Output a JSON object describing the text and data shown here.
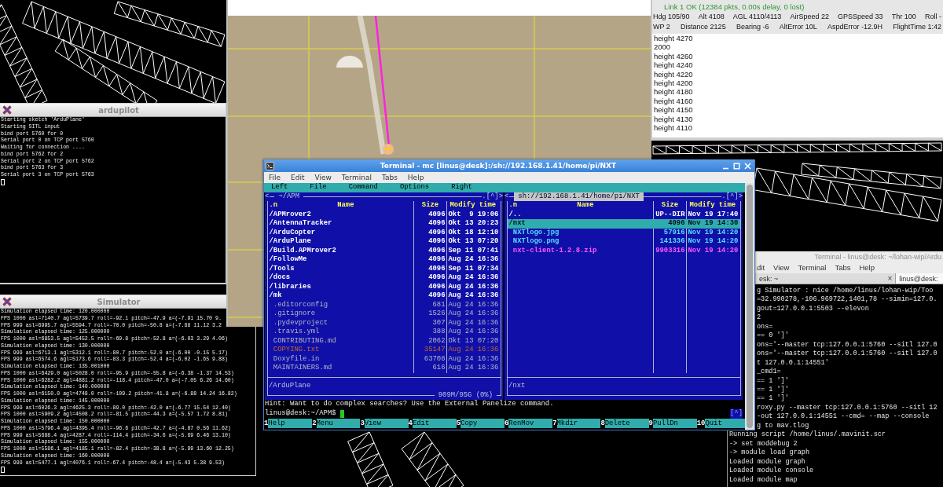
{
  "ardupilot_window": {
    "title": "ardupilot",
    "lines": [
      "Starting sketch 'ArduPlane'",
      "Starting SITL input",
      "bind port 5760 for 0",
      "Serial port 0 on TCP port 5760",
      "Waiting for connection ....",
      "bind port 5762 for 2",
      "Serial port 2 on TCP port 5762",
      "bind port 5763 for 3",
      "Serial port 3 on TCP port 5763"
    ]
  },
  "simulator_window": {
    "title": "Simulator",
    "lines": [
      "Simulation elapsed time: 120.000000",
      "FPS 1000 asl=7140.7 agl=5739.7 roll=-92.1 pitch=-47.9 a=(-7.91 15.70 9.",
      "FPS 999 asl=6995.7 agl=5594.7 roll=-70.0 pitch=-50.8 a=(-7.68 11.12 3.2",
      "Simulation elapsed time: 125.000000",
      "FPS 1000 asl=6853.5 agl=5452.5 roll=-69.8 pitch=-52.8 a=(-6.03 3.29 4.06)",
      "Simulation elapsed time: 130.000000",
      "FPS 999 asl=6713.1 agl=5312.1 roll=-80.7 pitch=-52.0 a=(-6.00 -0.15 5.17)",
      "FPS 999 asl=6574.6 agl=5173.6 roll=-83.3 pitch=-52.4 a=(-6.02 -1.65 9.88)",
      "Simulation elapsed time: 135.001000",
      "FPS 1000 asl=6429.0 agl=5028.0 roll=-95.9 pitch=-55.8 a=(-6.38 -1.37 14.53)",
      "FPS 1000 asl=6282.2 agl=4881.2 roll=-118.4 pitch=-47.0 a=(-7.05 6.26 14.60)",
      "Simulation elapsed time: 140.000000",
      "FPS 1000 asl=6150.0 agl=4749.0 roll=-109.2 pitch=-41.8 a=(-6.88 14.24 16.82)",
      "Simulation elapsed time: 145.000000",
      "FPS 999 asl=6026.3 agl=4625.3 roll=-89.0 pitch=-42.0 a=(-6.77 15.54 12.40)",
      "FPS 1000 asl=5909.2 agl=4508.2 roll=-81.5 pitch=-44.3 a=(-5.57 1.72 8.81)",
      "Simulation elapsed time: 150.000000",
      "FPS 1000 asl=5796.4 agl=4395.4 roll=-96.6 pitch=-42.7 a=(-4.87 0.56 11.62)",
      "FPS 999 asl=5688.4 agl=4287.4 roll=-114.4 pitch=-34.6 a=(-5.69 6.46 13.10)",
      "Simulation elapsed time: 155.000000",
      "FPS 1000 asl=5586.1 agl=4185.1 roll=-82.4 pitch=-38.8 a=(-5.99 13.60 12.25)",
      "Simulation elapsed time: 160.000000",
      "FPS 999 asl=5477.1 agl=4076.1 roll=-67.4 pitch=-48.4 a=(-5.43 5.38 9.53)"
    ]
  },
  "mavproxy_console": {
    "link_status": "Link 1 OK (12384 pkts, 0.00s delay, 0 lost)",
    "link_ok": true,
    "status_rows": [
      [
        "Hdg 105/90",
        "Alt 4108",
        "AGL 4110/4113",
        "AirSpeed 22",
        "GPSSpeed 33",
        "Thr 100",
        "Roll -"
      ],
      [
        "WP 2",
        "Distance 2125",
        "Bearing -6",
        "AltError 10L",
        "AspdError -12.9H",
        "FlightTime 1:42"
      ]
    ],
    "messages": [
      "height 4270",
      "2000",
      "height 4260",
      "height 4240",
      "height 4220",
      "height 4200",
      "height 4180",
      "height 4160",
      "height 4150",
      "height 4130",
      "height 4110"
    ]
  },
  "lohan_terminal": {
    "title": "Terminal - linus@desk: ~/lohan-wip/Ardu",
    "menu": [
      "dit",
      "View",
      "Terminal",
      "Tabs",
      "Help"
    ],
    "tabs": [
      {
        "label": "esk: ~",
        "close": "×",
        "selected": false
      },
      {
        "label": "linus@desk:",
        "selected": true
      }
    ],
    "overlapped_lines": [
      "g Simulator : nice /home/linus/lohan-wip/Too",
      "=32.990278,-106.969722,1401,78 --simin=127.0.",
      "gout=127.0.0.1:5503 --elevon",
      "2",
      "ons=",
      "== 0 ']'",
      "ons='--master tcp:127.0.0.1:5760 --sitl 127.0",
      "ons='--master tcp:127.0.0.1:5760 --sitl 127.0",
      "t 127.0.0.1:14551'",
      "_cmd1=",
      "== 1 ']'",
      "== 1 ']'",
      "== 1 ']'",
      "roxy.py --master tcp:127.0.0.1:5760 --sitl 12",
      "-out 127.0.0.1:14551 --cmd= --map --console",
      "g to mav.tlog"
    ],
    "lines": [
      "Running script /home/linus/.mavinit.scr",
      "-> set moddebug 2",
      "-> module load graph",
      "Loaded module graph",
      "Loaded module console",
      "Loaded module map"
    ]
  },
  "mc_window": {
    "title": "Terminal - mc [linus@desk]:/sh://192.168.1.41/home/pi/NXT",
    "menu": [
      "File",
      "Edit",
      "View",
      "Terminal",
      "Tabs",
      "Help"
    ],
    "mc_menu": [
      "Left",
      "File",
      "Command",
      "Options",
      "Right"
    ],
    "panels": [
      {
        "history_button": "<",
        "path": "~/APM",
        "frame_buttons": ".[^]>",
        "active": false,
        "columns": [
          ".n",
          "Name",
          "Size",
          "Modify time"
        ],
        "rows": [
          {
            "name": "/APMrover2",
            "size": "4096",
            "modified": "Okt  9 19:06",
            "kind": "directory",
            "selected": false
          },
          {
            "name": "/AntennaTracker",
            "size": "4096",
            "modified": "Okt 13 20:23",
            "kind": "directory",
            "selected": false
          },
          {
            "name": "/ArduCopter",
            "size": "4096",
            "modified": "Okt 18 12:10",
            "kind": "directory",
            "selected": false
          },
          {
            "name": "/ArduPlane",
            "size": "4096",
            "modified": "Okt 13 07:20",
            "kind": "directory",
            "selected": false
          },
          {
            "name": "/Build.APMrover2",
            "size": "4096",
            "modified": "Sep 11 07:41",
            "kind": "directory",
            "selected": false
          },
          {
            "name": "/FollowMe",
            "size": "4096",
            "modified": "Aug 24 16:36",
            "kind": "directory",
            "selected": false
          },
          {
            "name": "/Tools",
            "size": "4096",
            "modified": "Sep 11 07:34",
            "kind": "directory",
            "selected": false
          },
          {
            "name": "/docs",
            "size": "4096",
            "modified": "Aug 24 16:36",
            "kind": "directory",
            "selected": false
          },
          {
            "name": "/libraries",
            "size": "4096",
            "modified": "Aug 24 16:36",
            "kind": "directory",
            "selected": false
          },
          {
            "name": "/mk",
            "size": "4096",
            "modified": "Aug 24 16:36",
            "kind": "directory",
            "selected": false
          },
          {
            "name": ".editorconfig",
            "size": "681",
            "modified": "Aug 24 16:36",
            "kind": "file",
            "selected": false
          },
          {
            "name": ".gitignore",
            "size": "1526",
            "modified": "Aug 24 16:36",
            "kind": "file",
            "selected": false
          },
          {
            "name": ".pydevproject",
            "size": "307",
            "modified": "Aug 24 16:36",
            "kind": "file",
            "selected": false
          },
          {
            "name": ".travis.yml",
            "size": "388",
            "modified": "Aug 24 16:36",
            "kind": "file",
            "selected": false
          },
          {
            "name": "CONTRIBUTING.md",
            "size": "2062",
            "modified": "Okt 13 07:20",
            "kind": "file",
            "selected": false
          },
          {
            "name": "COPYING.txt",
            "size": "35147",
            "modified": "Aug 24 16:36",
            "kind": "document",
            "selected": false
          },
          {
            "name": "Doxyfile.in",
            "size": "63708",
            "modified": "Aug 24 16:36",
            "kind": "file",
            "selected": false
          },
          {
            "name": "MAINTAINERS.md",
            "size": "616",
            "modified": "Aug 24 16:36",
            "kind": "file",
            "selected": false
          }
        ],
        "mini_status": "/ArduPlane",
        "disk_info": "909M/95G (0%)"
      },
      {
        "history_button": "<",
        "path": "sh://192.168.1.41/home/pi/NXT",
        "frame_buttons": ".[^]>",
        "active": true,
        "columns": [
          ".n",
          "Name",
          "Size",
          "Modify time"
        ],
        "rows": [
          {
            "name": "/..",
            "size": "UP--DIR",
            "modified": "Nov 19 17:40",
            "kind": "directory",
            "selected": false
          },
          {
            "name": "/nxt",
            "size": "4096",
            "modified": "Nov 19 14:30",
            "kind": "directory",
            "selected": true
          },
          {
            "name": "NXTlogo.jpg",
            "size": "57916",
            "modified": "Nov 19 14:20",
            "kind": "image",
            "selected": false
          },
          {
            "name": "NXTlogo.png",
            "size": "141336",
            "modified": "Nov 19 14:20",
            "kind": "image",
            "selected": false
          },
          {
            "name": "nxt-client-1.2.8.zip",
            "size": "9903316",
            "modified": "Nov 19 14:20",
            "kind": "archive",
            "selected": false
          }
        ],
        "mini_status": "/nxt"
      }
    ],
    "hint": "Hint: Want to do complex searches? Use the External Panelize command.",
    "prompt": "linus@desk:~/APM$",
    "corner_button": "[^]",
    "function_keys": [
      {
        "key": "1",
        "label": "Help"
      },
      {
        "key": "2",
        "label": "Menu"
      },
      {
        "key": "3",
        "label": "View"
      },
      {
        "key": "4",
        "label": "Edit"
      },
      {
        "key": "5",
        "label": "Copy"
      },
      {
        "key": "6",
        "label": "RenMov"
      },
      {
        "key": "7",
        "label": "Mkdir"
      },
      {
        "key": "8",
        "label": "Delete"
      },
      {
        "key": "9",
        "label": "PullDn"
      },
      {
        "key": "10",
        "label": "Quit"
      }
    ]
  }
}
